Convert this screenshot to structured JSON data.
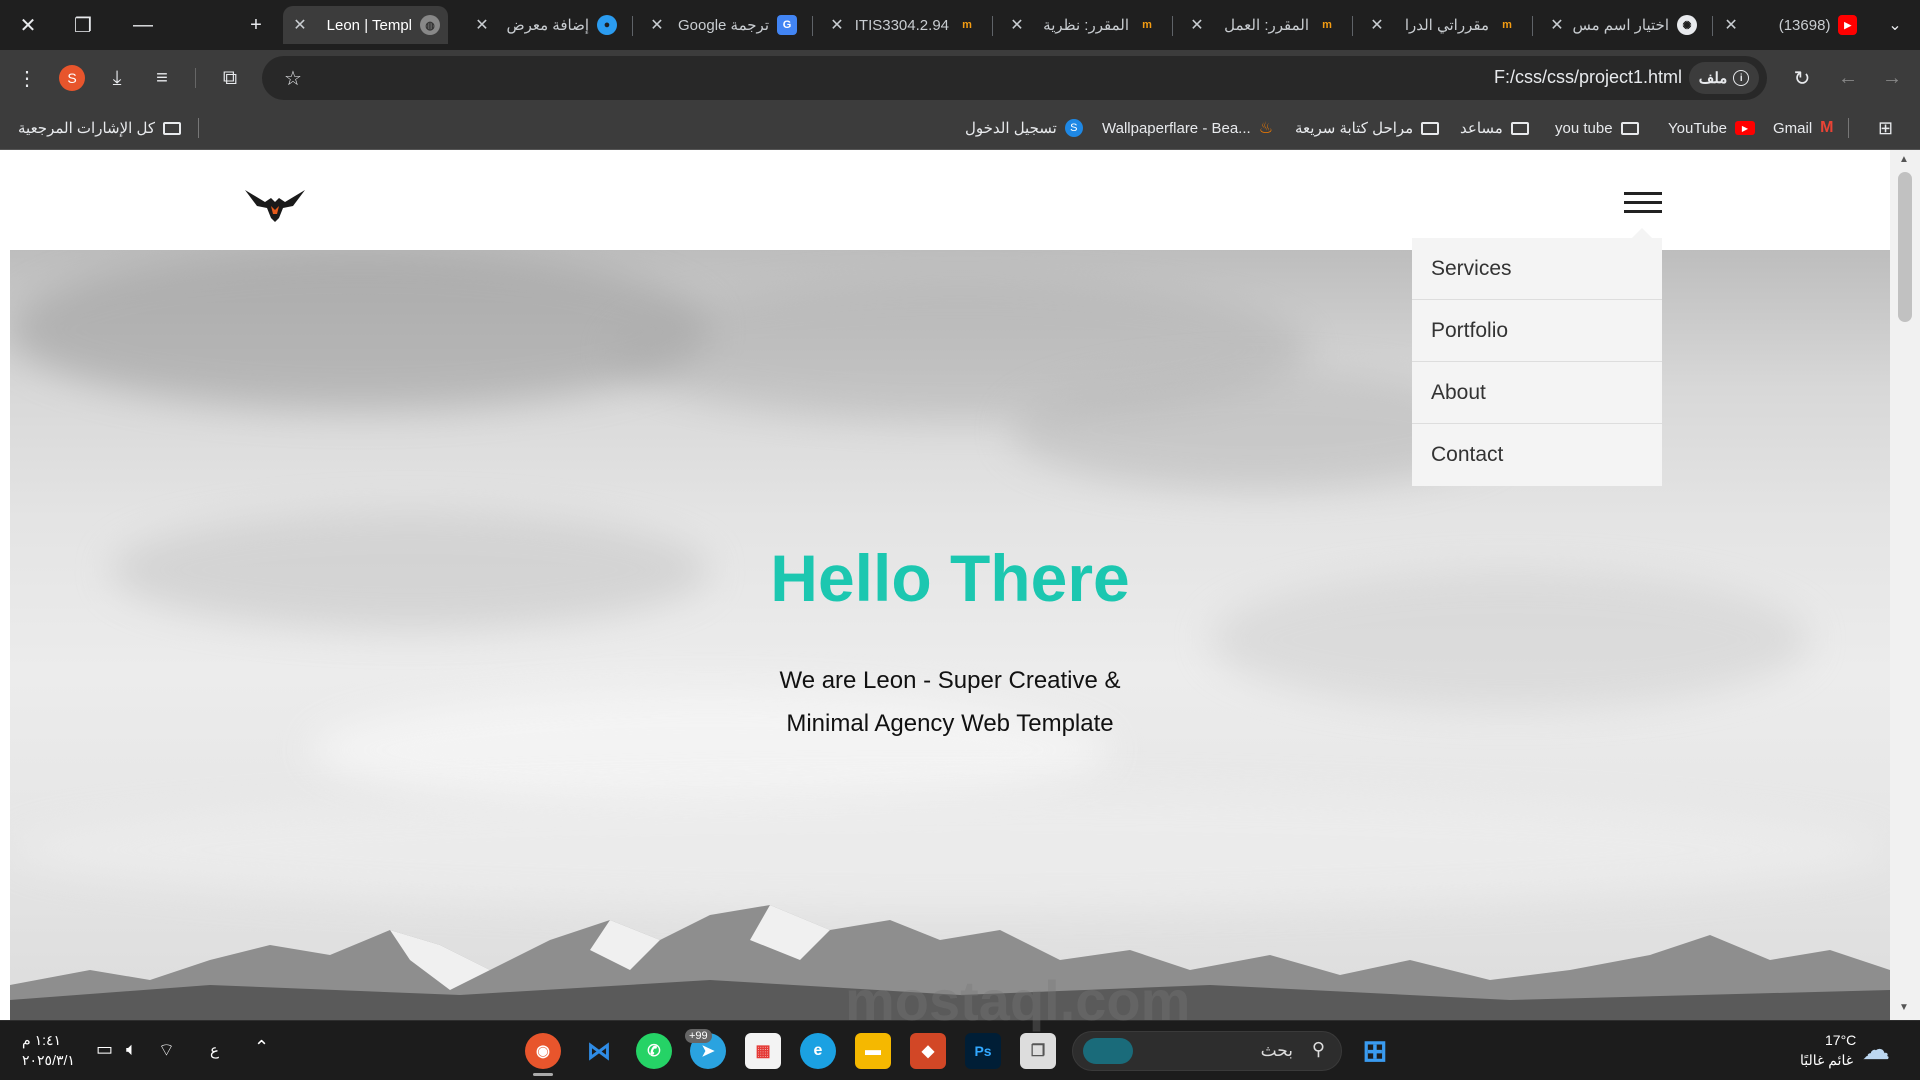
{
  "browser": {
    "tabs": [
      {
        "title": "Leon | Templ",
        "favicon": "globe",
        "active": true
      },
      {
        "title": "إضافة معرض",
        "favicon": "circle-blue"
      },
      {
        "title": "ترجمة Google",
        "favicon": "g-translate"
      },
      {
        "title": "94.ITIS3304.2",
        "favicon": "m-orange"
      },
      {
        "title": "المقرر: نظرية",
        "favicon": "m-orange"
      },
      {
        "title": "المقرر: العمل",
        "favicon": "m-orange"
      },
      {
        "title": "مقرراتي الدرا",
        "favicon": "m-orange"
      },
      {
        "title": "اختيار اسم مس",
        "favicon": "openai"
      },
      {
        "title": "(13698) ",
        "favicon": "youtube"
      }
    ],
    "url": "F:/css/css/project1.html",
    "site_chip": "ملف",
    "profile_initial": "S",
    "bookmarks_left": "كل الإشارات المرجعية",
    "bookmarks": [
      {
        "label": "تسجيل الدخول",
        "icon": "login-icon"
      },
      {
        "label": "Wallpaperflare - Bea...",
        "icon": "flame-icon"
      },
      {
        "label": "مراحل كتابة سريعة",
        "icon": "folder-icon"
      },
      {
        "label": "مساعد",
        "icon": "folder-icon"
      },
      {
        "label": "you tube",
        "icon": "folder-icon"
      },
      {
        "label": "YouTube",
        "icon": "youtube-icon"
      },
      {
        "label": "Gmail",
        "icon": "gmail-icon"
      }
    ]
  },
  "page": {
    "menu": [
      "Services",
      "Portfolio",
      "About",
      "Contact"
    ],
    "hero_title": "Hello There",
    "hero_sub_line1": "We are Leon - Super Creative &",
    "hero_sub_line2": "Minimal Agency Web Template",
    "accent_color": "#1cc7b0"
  },
  "taskbar": {
    "time": "١:٤١ م",
    "date": "٢٠٢٥/٣/١",
    "lang": "ع",
    "search_placeholder": "بحث",
    "weather_temp": "17°C",
    "weather_desc": "غائم غالبًا",
    "telegram_badge": "+99"
  },
  "watermark": "mostaql.com"
}
